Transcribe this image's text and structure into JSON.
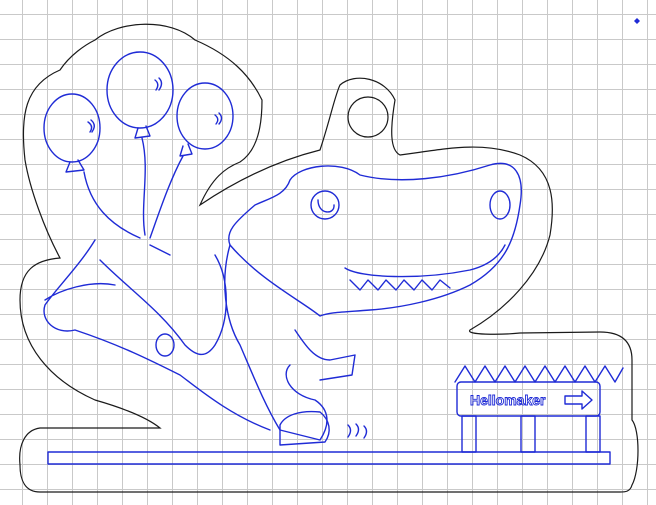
{
  "sign": {
    "text": "Hellomaker"
  },
  "colors": {
    "cut_outline": "#1a1a1a",
    "artwork_stroke": "#1f2bd6",
    "grid": "#c9c9c9",
    "background": "#ffffff"
  },
  "icons": {
    "corner_marker": "diamond-icon",
    "arrow": "arrow-right-icon"
  }
}
